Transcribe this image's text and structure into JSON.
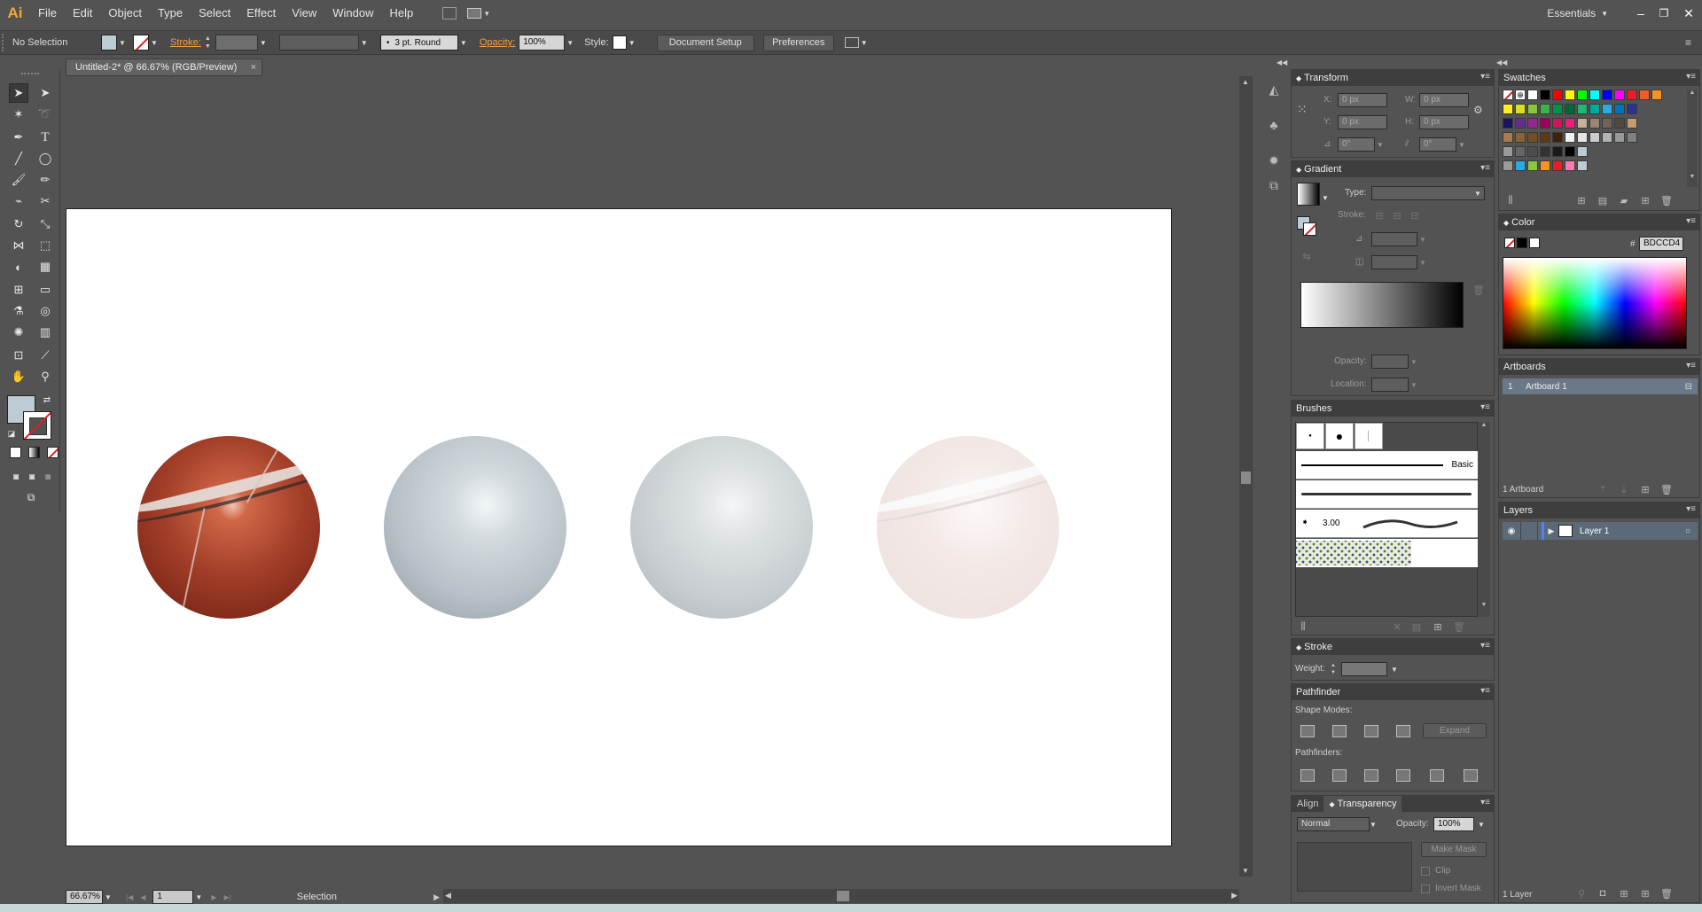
{
  "app": {
    "logo": "Ai",
    "workspace": "Essentials",
    "window_controls": [
      "minimize-icon",
      "restore-icon",
      "close-icon"
    ]
  },
  "menu": [
    "File",
    "Edit",
    "Object",
    "Type",
    "Select",
    "Effect",
    "View",
    "Window",
    "Help"
  ],
  "control_bar": {
    "selection_state": "No Selection",
    "stroke_label": "Stroke:",
    "brush_profile": "3 pt. Round",
    "opacity_label": "Opacity:",
    "opacity_value": "100%",
    "style_label": "Style:",
    "document_setup": "Document Setup",
    "preferences": "Preferences"
  },
  "document": {
    "tab_title": "Untitled-2* @ 66.67% (RGB/Preview)",
    "close": "×"
  },
  "status": {
    "zoom": "66.67%",
    "artboard_nav": "1",
    "tool": "Selection"
  },
  "artwork": {
    "spheres": [
      {
        "name": "marble-sphere",
        "colors": [
          "#e07a5a",
          "#9b3a22",
          "#4a140a"
        ]
      },
      {
        "name": "blue-gray-sphere",
        "colors": [
          "#f2f6f8",
          "#bcc6cc",
          "#8a969d"
        ]
      },
      {
        "name": "light-gray-sphere",
        "colors": [
          "#f4f6f7",
          "#ccd2d5",
          "#a9b0b4"
        ]
      },
      {
        "name": "faded-marble-sphere",
        "colors": [
          "#f8efed",
          "#efe3e0",
          "#e9dcda"
        ]
      }
    ]
  },
  "panels": {
    "transform": {
      "title": "Transform",
      "x_label": "X:",
      "x_value": "0 px",
      "y_label": "Y:",
      "y_value": "0 px",
      "w_label": "W:",
      "w_value": "0 px",
      "h_label": "H:",
      "h_value": "0 px",
      "rotate_value": "0°",
      "shear_value": "0°"
    },
    "gradient": {
      "title": "Gradient",
      "type_label": "Type:",
      "stroke_label": "Stroke:",
      "opacity_label": "Opacity:",
      "location_label": "Location:"
    },
    "brushes": {
      "title": "Brushes",
      "basic_label": "Basic",
      "size_label": "3.00"
    },
    "stroke": {
      "title": "Stroke",
      "weight_label": "Weight:"
    },
    "pathfinder": {
      "title": "Pathfinder",
      "shape_modes_label": "Shape Modes:",
      "pathfinders_label": "Pathfinders:",
      "expand": "Expand"
    },
    "transparency": {
      "align_tab": "Align",
      "title": "Transparency",
      "blend_mode": "Normal",
      "opacity_label": "Opacity:",
      "opacity_value": "100%",
      "make_mask": "Make Mask",
      "clip": "Clip",
      "invert_mask": "Invert Mask"
    },
    "swatches": {
      "title": "Swatches",
      "row1": [
        "#ffffff",
        "#000000",
        "#ff0000",
        "#ffff00",
        "#00ff00",
        "#00ffff",
        "#0000ff",
        "#ff00ff",
        "#ed1c24",
        "#f15a24",
        "#f7931e"
      ],
      "row2": [
        "#fcee21",
        "#d9e021",
        "#8cc63f",
        "#39b54a",
        "#009245",
        "#006837",
        "#22b573",
        "#00a99d",
        "#29abe2",
        "#0071bc",
        "#2e3192"
      ],
      "row3": [
        "#1b1464",
        "#662d91",
        "#93278f",
        "#9e005d",
        "#d4145a",
        "#ed1e79",
        "#c7b299",
        "#998675",
        "#736357",
        "#534741",
        "#c69c6d"
      ],
      "row4": [
        "#a67c52",
        "#8c6239",
        "#754c24",
        "#603813",
        "#42210b",
        "#f2f2f2",
        "#e6e6e6",
        "#cccccc",
        "#b3b3b3",
        "#999999",
        "#808080"
      ],
      "row5": [
        "#666666",
        "#4d4d4d",
        "#333333",
        "#1a1a1a",
        "#000000",
        "#bdccd4"
      ],
      "row6": [
        "#29abe2",
        "#8cc63f",
        "#f7931e",
        "#ed1c24",
        "#ff7bac",
        "#bdccd4"
      ]
    },
    "color": {
      "title": "Color",
      "hex_label": "#",
      "hex_value": "BDCCD4"
    },
    "artboards": {
      "title": "Artboards",
      "row_index": "1",
      "row_name": "Artboard 1",
      "footer": "1 Artboard"
    },
    "layers": {
      "title": "Layers",
      "layer_name": "Layer 1",
      "footer": "1 Layer"
    }
  },
  "colors": {
    "fill": "#bdccd4",
    "ui_bg": "#535353",
    "panel_header": "#3e3e3e",
    "accent_orange": "#f3a73b"
  }
}
